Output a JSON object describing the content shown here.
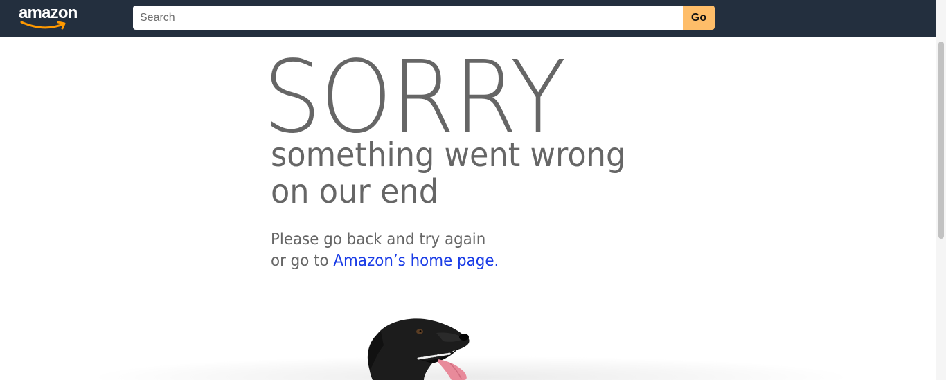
{
  "header": {
    "logo_text": "amazon",
    "search": {
      "placeholder": "Search",
      "value": ""
    },
    "go_label": "Go"
  },
  "error": {
    "title": "SORRY",
    "subtitle_line1": "something went wrong",
    "subtitle_line2": "on our end",
    "message_line1": "Please go back and try again",
    "message_line2_prefix": "or go to ",
    "home_link": "Amazon’s home page."
  },
  "colors": {
    "header_bg": "#232f3e",
    "go_button": "#febd69",
    "logo_smile": "#ff9900",
    "text_gray": "#666666",
    "link_blue": "#1a3ce6"
  },
  "icons": {
    "logo_smile": "amazon-smile-arrow",
    "illustration": "dog-image"
  }
}
